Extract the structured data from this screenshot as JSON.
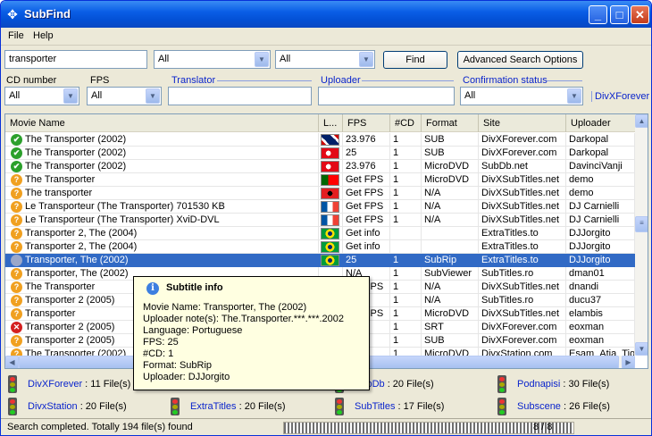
{
  "window": {
    "title": "SubFind"
  },
  "menu": [
    "File",
    "Help"
  ],
  "search": {
    "query": "transporter",
    "lang1": "All",
    "lang2": "All",
    "find_label": "Find",
    "advanced_label": "Advanced Search Options"
  },
  "filters": {
    "cd_label": "CD number",
    "cd_value": "All",
    "fps_label": "FPS",
    "fps_value": "All",
    "translator_label": "Translator",
    "translator_value": "",
    "uploader_label": "Uploader",
    "uploader_value": "",
    "confirm_label": "Confirmation status",
    "confirm_value": "All",
    "site_link": "DivXForever"
  },
  "grid": {
    "columns": [
      "Movie Name",
      "L...",
      "FPS",
      "#CD",
      "Format",
      "Site",
      "Uploader"
    ],
    "rows": [
      {
        "status": "ok",
        "name": "The Transporter (2002)",
        "flag": "uk",
        "fps": "23.976",
        "cd": "1",
        "format": "SUB",
        "site": "DivXForever.com",
        "uploader": "Darkopal"
      },
      {
        "status": "ok",
        "name": "The Transporter (2002)",
        "flag": "tr",
        "fps": "25",
        "cd": "1",
        "format": "SUB",
        "site": "DivXForever.com",
        "uploader": "Darkopal"
      },
      {
        "status": "ok",
        "name": "The Transporter (2002)",
        "flag": "tr",
        "fps": "23.976",
        "cd": "1",
        "format": "MicroDVD",
        "site": "SubDb.net",
        "uploader": "DavinciVanji"
      },
      {
        "status": "q",
        "name": "The Transporter",
        "flag": "pt",
        "fps": "Get FPS",
        "cd": "1",
        "format": "MicroDVD",
        "site": "DivXSubTitles.net",
        "uploader": "demo"
      },
      {
        "status": "q",
        "name": "The transporter",
        "flag": "al",
        "fps": "Get FPS",
        "cd": "1",
        "format": "N/A",
        "site": "DivXSubTitles.net",
        "uploader": "demo"
      },
      {
        "status": "q",
        "name": "Le Transporteur (The Transporter) 701530 KB",
        "flag": "fr",
        "fps": "Get FPS",
        "cd": "1",
        "format": "N/A",
        "site": "DivXSubTitles.net",
        "uploader": "DJ Carnielli"
      },
      {
        "status": "q",
        "name": "Le Transporteur (The Transporter) XviD-DVL",
        "flag": "fr",
        "fps": "Get FPS",
        "cd": "1",
        "format": "N/A",
        "site": "DivXSubTitles.net",
        "uploader": "DJ Carnielli"
      },
      {
        "status": "q",
        "name": "Transporter 2, The (2004)",
        "flag": "br",
        "fps": "Get info",
        "cd": "",
        "format": "",
        "site": "ExtraTitles.to",
        "uploader": "DJJorgito"
      },
      {
        "status": "q",
        "name": "Transporter 2, The (2004)",
        "flag": "br",
        "fps": "Get info",
        "cd": "",
        "format": "",
        "site": "ExtraTitles.to",
        "uploader": "DJJorgito"
      },
      {
        "status": "sel",
        "name": "Transporter, The (2002)",
        "flag": "br",
        "fps": "25",
        "cd": "1",
        "format": "SubRip",
        "site": "ExtraTitles.to",
        "uploader": "DJJorgito",
        "selected": true
      },
      {
        "status": "q",
        "name": "Transporter, The (2002)",
        "flag": "",
        "fps": "N/A",
        "cd": "1",
        "format": "SubViewer",
        "site": "SubTitles.ro",
        "uploader": "dman01"
      },
      {
        "status": "q",
        "name": "The Transporter",
        "flag": "",
        "fps": "Get FPS",
        "cd": "1",
        "format": "N/A",
        "site": "DivXSubTitles.net",
        "uploader": "dnandi"
      },
      {
        "status": "q",
        "name": "Transporter 2 (2005)",
        "flag": "",
        "fps": "N/A",
        "cd": "1",
        "format": "N/A",
        "site": "SubTitles.ro",
        "uploader": "ducu37"
      },
      {
        "status": "q",
        "name": "Transporter",
        "flag": "",
        "fps": "Get FPS",
        "cd": "1",
        "format": "MicroDVD",
        "site": "DivXSubTitles.net",
        "uploader": "elambis"
      },
      {
        "status": "x",
        "name": "Transporter 2 (2005)",
        "flag": "",
        "fps": "",
        "cd": "1",
        "format": "SRT",
        "site": "DivXForever.com",
        "uploader": "eoxman"
      },
      {
        "status": "q",
        "name": "Transporter 2 (2005)",
        "flag": "",
        "fps": "",
        "cd": "1",
        "format": "SUB",
        "site": "DivXForever.com",
        "uploader": "eoxman"
      },
      {
        "status": "q",
        "name": "The Transporter (2002)",
        "flag": "",
        "fps": "",
        "cd": "1",
        "format": "MicroDVD",
        "site": "DivxStation.com",
        "uploader": "Esam_Atia_Tiq"
      }
    ]
  },
  "tooltip": {
    "title": "Subtitle info",
    "lines": [
      "Movie Name: Transporter, The (2002)",
      "Uploader note(s): The.Transporter.***.***.2002",
      "Language: Portuguese",
      "FPS: 25",
      "#CD: 1",
      "Format: SubRip",
      "Uploader: DJJorgito"
    ]
  },
  "sites": [
    {
      "name": "DivXForever",
      "count": " : 11 File(s)"
    },
    {
      "name": "",
      "count": ""
    },
    {
      "name": "SubDb",
      "count": " : 20 File(s)"
    },
    {
      "name": "Podnapisi",
      "count": " : 30 File(s)"
    },
    {
      "name": "DivxStation",
      "count": " : 20 File(s)"
    },
    {
      "name": "ExtraTitles",
      "count": " : 20 File(s)"
    },
    {
      "name": "SubTitles",
      "count": " : 17 File(s)"
    },
    {
      "name": "Subscene",
      "count": " : 26 File(s)"
    }
  ],
  "status": {
    "text": "Search completed. Totally 194 file(s) found",
    "progress_text": "8 / 8",
    "progress": 1.0
  }
}
